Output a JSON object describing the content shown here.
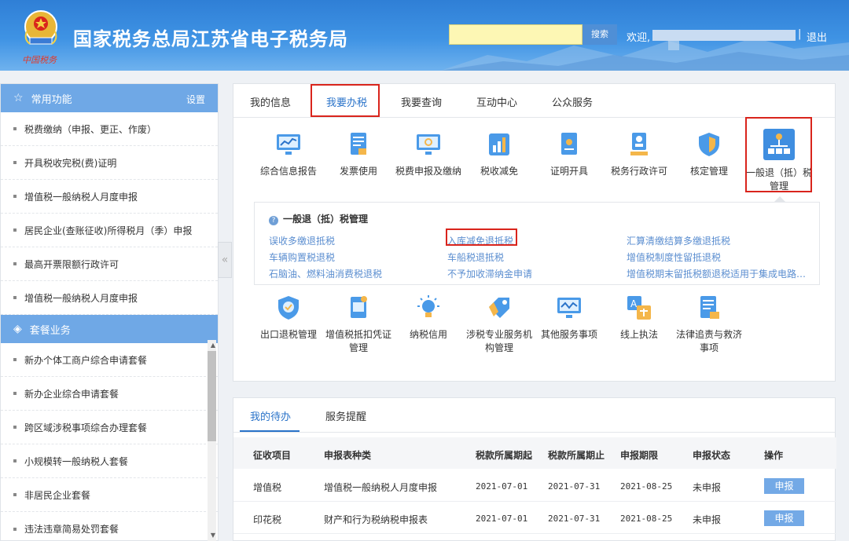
{
  "header": {
    "title": "国家税务总局江苏省电子税务局",
    "logo_sub": "中国税务",
    "search_button": "搜索",
    "search_placeholder": "",
    "welcome": "欢迎,",
    "separator": "|",
    "logout": "退出"
  },
  "sidebar": {
    "common": {
      "title": "常用功能",
      "setting": "设置",
      "items": [
        {
          "label": "税费缴纳（申报、更正、作废）"
        },
        {
          "label": "开具税收完税(费)证明"
        },
        {
          "label": "增值税一般纳税人月度申报"
        },
        {
          "label": "居民企业(查账征收)所得税月（季）申报"
        },
        {
          "label": "最高开票限额行政许可"
        },
        {
          "label": "增值税一般纳税人月度申报"
        }
      ]
    },
    "packages": {
      "title": "套餐业务",
      "items": [
        {
          "label": "新办个体工商户综合申请套餐"
        },
        {
          "label": "新办企业综合申请套餐"
        },
        {
          "label": "跨区域涉税事项综合办理套餐"
        },
        {
          "label": "小规模转一般纳税人套餐"
        },
        {
          "label": "非居民企业套餐"
        },
        {
          "label": "违法违章简易处罚套餐"
        }
      ]
    },
    "collapse_icon": "«"
  },
  "main": {
    "tabs": [
      {
        "label": "我的信息"
      },
      {
        "label": "我要办税"
      },
      {
        "label": "我要查询"
      },
      {
        "label": "互动中心"
      },
      {
        "label": "公众服务"
      }
    ],
    "active_tab": "我要办税",
    "apps_row1": [
      {
        "label": "综合信息报告",
        "icon": "monitor-chart-icon"
      },
      {
        "label": "发票使用",
        "icon": "invoice-doc-icon"
      },
      {
        "label": "税费申报及缴纳",
        "icon": "monitor-refresh-icon"
      },
      {
        "label": "税收减免",
        "icon": "bar-chart-icon"
      },
      {
        "label": "证明开具",
        "icon": "certificate-icon"
      },
      {
        "label": "税务行政许可",
        "icon": "person-badge-icon"
      },
      {
        "label": "核定管理",
        "icon": "shield-icon"
      },
      {
        "label": "一般退（抵）税管理",
        "icon": "org-chart-icon"
      }
    ],
    "sub_panel": {
      "title": "一般退（抵）税管理",
      "links": [
        [
          "误收多缴退抵税",
          "入库减免退抵税",
          "汇算清缴结算多缴退抵税"
        ],
        [
          "车辆购置税退税",
          "车船税退抵税",
          "增值税制度性留抵退税"
        ],
        [
          "石脑油、燃料油消费税退税",
          "不予加收滞纳金申请",
          "增值税期末留抵税额退税适用于集成电路…"
        ]
      ]
    },
    "apps_row2": [
      {
        "label": "出口退税管理",
        "icon": "shield-check-icon"
      },
      {
        "label": "增值税抵扣凭证管理",
        "icon": "voucher-icon"
      },
      {
        "label": "纳税信用",
        "icon": "credit-bulb-icon"
      },
      {
        "label": "涉税专业服务机构管理",
        "icon": "tag-icon"
      },
      {
        "label": "其他服务事项",
        "icon": "monitor-wave-icon"
      },
      {
        "label": "线上执法",
        "icon": "translate-icon"
      },
      {
        "label": "法律追责与救济事项",
        "icon": "law-doc-icon"
      }
    ]
  },
  "todo": {
    "tabs": [
      {
        "label": "我的待办"
      },
      {
        "label": "服务提醒"
      }
    ],
    "columns": [
      "征收项目",
      "申报表种类",
      "税款所属期起",
      "税款所属期止",
      "申报期限",
      "申报状态",
      "操作"
    ],
    "rows": [
      {
        "item": "增值税",
        "form": "增值税一般纳税人月度申报",
        "start": "2021-07-01",
        "end": "2021-07-31",
        "deadline": "2021-08-25",
        "status": "未申报",
        "action": "申报"
      },
      {
        "item": "印花税",
        "form": "财产和行为税纳税申报表",
        "start": "2021-07-01",
        "end": "2021-07-31",
        "deadline": "2021-08-25",
        "status": "未申报",
        "action": "申报"
      }
    ]
  }
}
